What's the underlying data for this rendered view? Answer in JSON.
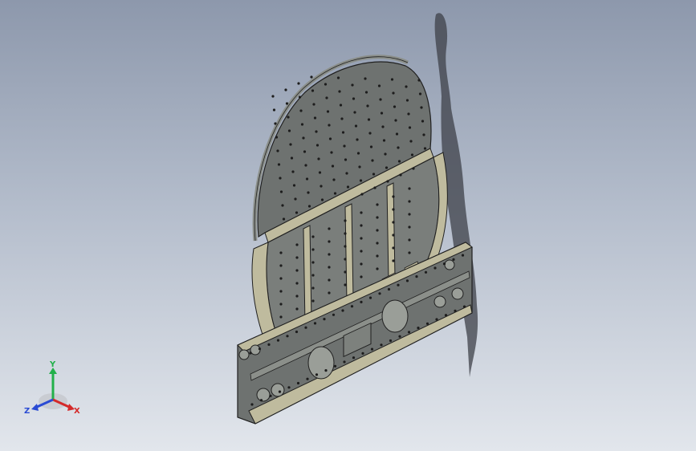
{
  "viewport": {
    "model_name": "",
    "triad": {
      "x_label": "X",
      "y_label": "Y",
      "z_label": "Z",
      "x_color": "#d42a2a",
      "y_color": "#22b04a",
      "z_color": "#2a4bd4"
    }
  },
  "colors": {
    "part_fill": "#6e7270",
    "part_light": "#8b8f8a",
    "part_cream": "#bfbb9e",
    "edge": "#202020",
    "shadow": "#3e4048"
  }
}
